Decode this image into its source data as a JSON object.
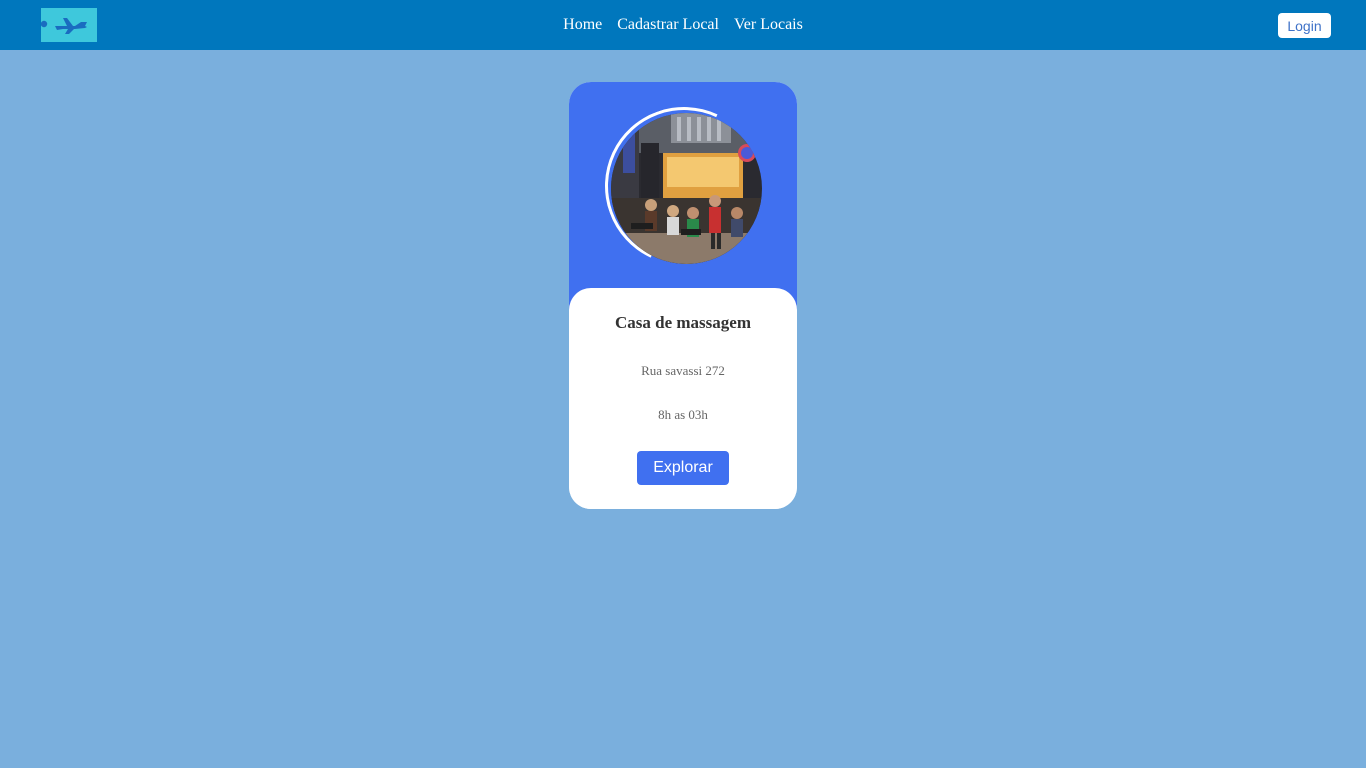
{
  "header": {
    "logo_icon": "airplane-icon",
    "nav": [
      {
        "label": "Home"
      },
      {
        "label": "Cadastrar Local"
      },
      {
        "label": "Ver Locais"
      }
    ],
    "login_label": "Login"
  },
  "card": {
    "title": "Casa de massagem",
    "address": "Rua savassi 272",
    "hours": "8h as 03h",
    "button_label": "Explorar"
  },
  "colors": {
    "background": "#7aafdd",
    "navbar": "#0077bd",
    "logo_bg": "#3ec8dc",
    "card_accent": "#4070f0"
  }
}
